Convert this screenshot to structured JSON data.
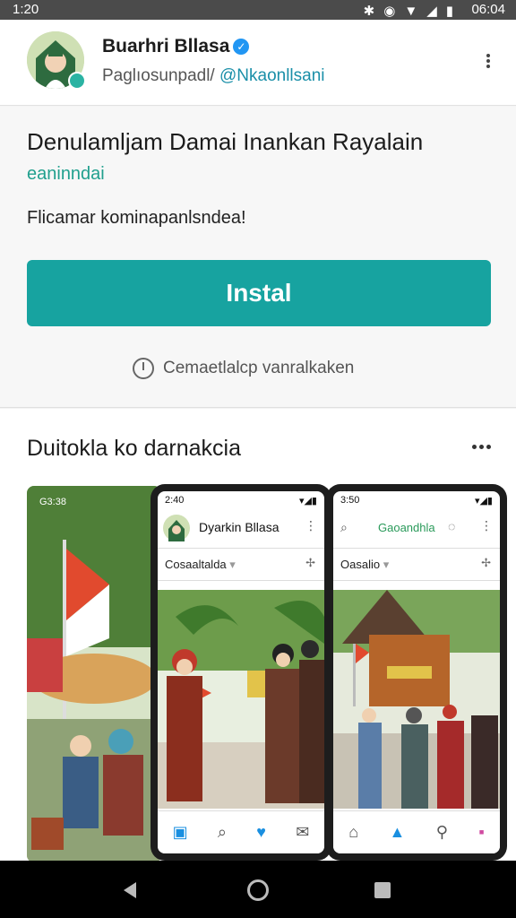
{
  "status_bar": {
    "time": "1:20",
    "clock": "06:04"
  },
  "profile": {
    "name": "Buarhri Bllasa",
    "handle_prefix": "Paglıosunpadl/",
    "handle": "@Nkaonllsani"
  },
  "app": {
    "title": "Denulamljam Damai Inankan Rayalain",
    "developer": "eaninndai",
    "description": "Flicamar kominapanlsndea!",
    "install_label": "Instal",
    "note": "Cemaetlalcp vanralkaken"
  },
  "gallery": {
    "title": "Duitokla ko darnakcia",
    "shot0_status": "G3:38",
    "phone1": {
      "time": "2:40",
      "name": "Dyarkin Bllasa",
      "sub": "Cosaaltalda"
    },
    "phone2": {
      "time": "3:50",
      "title": "Gaoandhla",
      "sub": "Oasalio"
    }
  },
  "colors": {
    "accent": "#17a3a0",
    "link": "#1a8fa8",
    "verified": "#2196f3"
  }
}
